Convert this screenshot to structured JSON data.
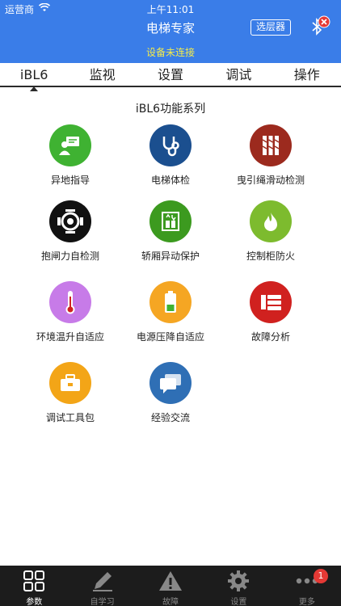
{
  "status_bar": {
    "carrier": "运营商",
    "time": "上午11:01"
  },
  "header": {
    "title": "电梯专家",
    "select_button": "选层器",
    "connection_status": "设备未连接",
    "background_color": "#3a7de8",
    "status_color": "#f5ec4a"
  },
  "tabs": [
    {
      "label": "iBL6",
      "active": true
    },
    {
      "label": "监视"
    },
    {
      "label": "设置"
    },
    {
      "label": "调试"
    },
    {
      "label": "操作"
    }
  ],
  "section_title": "iBL6功能系列",
  "features": [
    {
      "label": "异地指导",
      "icon": "remote-guide-icon",
      "color": "#3fb232"
    },
    {
      "label": "电梯体检",
      "icon": "stethoscope-icon",
      "color": "#1b4f8f"
    },
    {
      "label": "曳引绳滑动检测",
      "icon": "rope-slip-icon",
      "color": "#9c2a1e"
    },
    {
      "label": "抱闸力自检测",
      "icon": "brake-motor-icon",
      "color": "#111111"
    },
    {
      "label": "轿厢异动保护",
      "icon": "car-movement-icon",
      "color": "#3c9a1f"
    },
    {
      "label": "控制柜防火",
      "icon": "fire-icon",
      "color": "#7dbb2e"
    },
    {
      "label": "环境温升自适应",
      "icon": "thermometer-icon",
      "color": "#c77be8"
    },
    {
      "label": "电源压降自适应",
      "icon": "battery-icon",
      "color": "#f5a623"
    },
    {
      "label": "故障分析",
      "icon": "fault-analysis-icon",
      "color": "#d0211f"
    },
    {
      "label": "调试工具包",
      "icon": "toolbox-icon",
      "color": "#f3a517"
    },
    {
      "label": "经验交流",
      "icon": "chat-icon",
      "color": "#2f6fb5"
    }
  ],
  "tabbar": [
    {
      "label": "参数",
      "icon": "grid-icon",
      "active": true
    },
    {
      "label": "自学习",
      "icon": "pencil-icon"
    },
    {
      "label": "故障",
      "icon": "warning-icon"
    },
    {
      "label": "设置",
      "icon": "gear-icon"
    },
    {
      "label": "更多",
      "icon": "more-icon",
      "badge": "1"
    }
  ]
}
